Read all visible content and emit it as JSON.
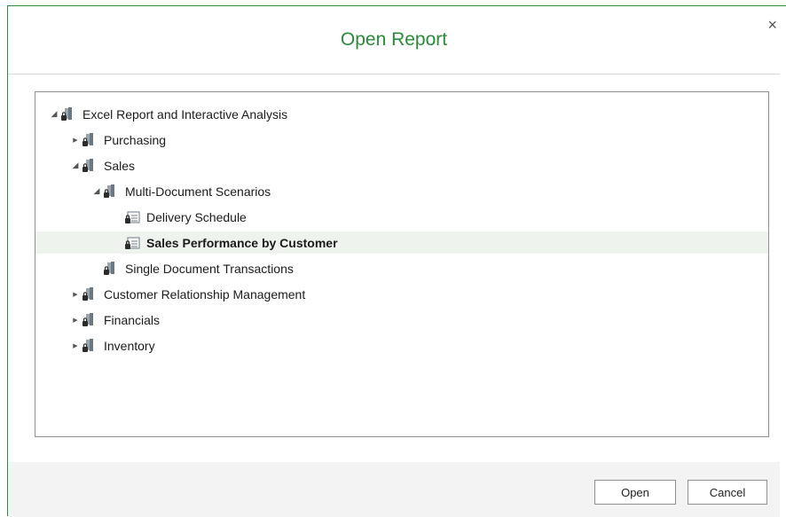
{
  "dialog": {
    "title": "Open Report",
    "close_glyph": "×"
  },
  "tree": {
    "items": [
      {
        "label": "Excel Report and Interactive Analysis",
        "level": 0,
        "arrow": "expanded",
        "icon": "locked-folder-icon"
      },
      {
        "label": "Purchasing",
        "level": 1,
        "arrow": "collapsed",
        "icon": "locked-folder-icon"
      },
      {
        "label": "Sales",
        "level": 1,
        "arrow": "expanded",
        "icon": "locked-folder-icon"
      },
      {
        "label": "Multi-Document Scenarios",
        "level": 2,
        "arrow": "expanded",
        "icon": "locked-folder-icon"
      },
      {
        "label": "Delivery Schedule",
        "level": 3,
        "arrow": "none",
        "icon": "locked-report-icon"
      },
      {
        "label": "Sales Performance by Customer",
        "level": 3,
        "arrow": "none",
        "icon": "locked-report-icon",
        "selected": true
      },
      {
        "label": "Single Document Transactions",
        "level": 2,
        "arrow": "none",
        "icon": "locked-folder-icon"
      },
      {
        "label": "Customer Relationship Management",
        "level": 1,
        "arrow": "collapsed",
        "icon": "locked-folder-icon"
      },
      {
        "label": "Financials",
        "level": 1,
        "arrow": "collapsed",
        "icon": "locked-folder-icon"
      },
      {
        "label": "Inventory",
        "level": 1,
        "arrow": "collapsed",
        "icon": "locked-folder-icon"
      }
    ]
  },
  "footer": {
    "open_label": "Open",
    "cancel_label": "Cancel"
  },
  "colors": {
    "title": "#2a8a3a",
    "accent_border": "#2f8a3d",
    "selection_bg": "#eef3ee",
    "footer_bg": "#f3f3f3"
  }
}
